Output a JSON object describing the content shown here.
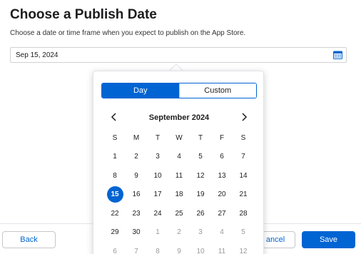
{
  "page": {
    "title": "Choose a Publish Date",
    "subtitle": "Choose a date or time frame when you expect to publish on the App Store."
  },
  "date_field": {
    "value": "Sep 15, 2024",
    "icon": "calendar-icon"
  },
  "picker": {
    "tabs": [
      {
        "label": "Day",
        "selected": true
      },
      {
        "label": "Custom",
        "selected": false
      }
    ],
    "month_label": "September 2024",
    "weekdays": [
      "S",
      "M",
      "T",
      "W",
      "T",
      "F",
      "S"
    ],
    "weeks": [
      [
        {
          "d": "1"
        },
        {
          "d": "2"
        },
        {
          "d": "3"
        },
        {
          "d": "4"
        },
        {
          "d": "5"
        },
        {
          "d": "6"
        },
        {
          "d": "7"
        }
      ],
      [
        {
          "d": "8"
        },
        {
          "d": "9"
        },
        {
          "d": "10"
        },
        {
          "d": "11"
        },
        {
          "d": "12"
        },
        {
          "d": "13"
        },
        {
          "d": "14"
        }
      ],
      [
        {
          "d": "15",
          "selected": true
        },
        {
          "d": "16"
        },
        {
          "d": "17"
        },
        {
          "d": "18"
        },
        {
          "d": "19"
        },
        {
          "d": "20"
        },
        {
          "d": "21"
        }
      ],
      [
        {
          "d": "22"
        },
        {
          "d": "23"
        },
        {
          "d": "24"
        },
        {
          "d": "25"
        },
        {
          "d": "26"
        },
        {
          "d": "27"
        },
        {
          "d": "28"
        }
      ],
      [
        {
          "d": "29"
        },
        {
          "d": "30"
        },
        {
          "d": "1",
          "muted": true
        },
        {
          "d": "2",
          "muted": true
        },
        {
          "d": "3",
          "muted": true
        },
        {
          "d": "4",
          "muted": true
        },
        {
          "d": "5",
          "muted": true
        }
      ],
      [
        {
          "d": "6",
          "muted": true
        },
        {
          "d": "7",
          "muted": true
        },
        {
          "d": "8",
          "muted": true
        },
        {
          "d": "9",
          "muted": true
        },
        {
          "d": "10",
          "muted": true
        },
        {
          "d": "11",
          "muted": true
        },
        {
          "d": "12",
          "muted": true
        }
      ]
    ]
  },
  "footer": {
    "back_label": "Back",
    "cancel_label": "ancel",
    "save_label": "Save"
  },
  "colors": {
    "accent": "#0064d2"
  }
}
